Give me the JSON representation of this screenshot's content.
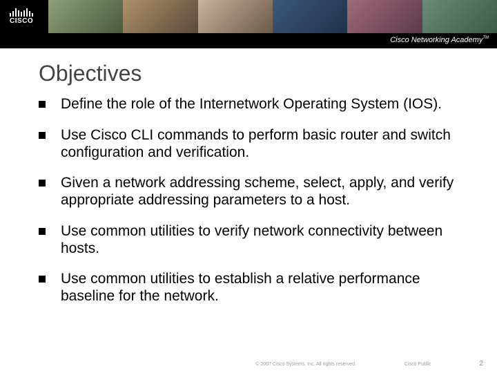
{
  "header": {
    "logo_text": "CISCO",
    "academy_text": "Cisco Networking Academy",
    "tm": "TM"
  },
  "title": "Objectives",
  "objectives": [
    "Define the role of the Internetwork Operating System (IOS).",
    "Use Cisco CLI commands to perform basic router and switch configuration and verification.",
    "Given a network addressing scheme, select, apply, and verify appropriate addressing parameters to a host.",
    "Use common utilities to verify network connectivity between hosts.",
    "Use common utilities to establish a relative performance baseline for the network."
  ],
  "footer": {
    "copyright": "© 2007 Cisco Systems, Inc. All rights reserved.",
    "classification": "Cisco Public",
    "page": "2"
  }
}
